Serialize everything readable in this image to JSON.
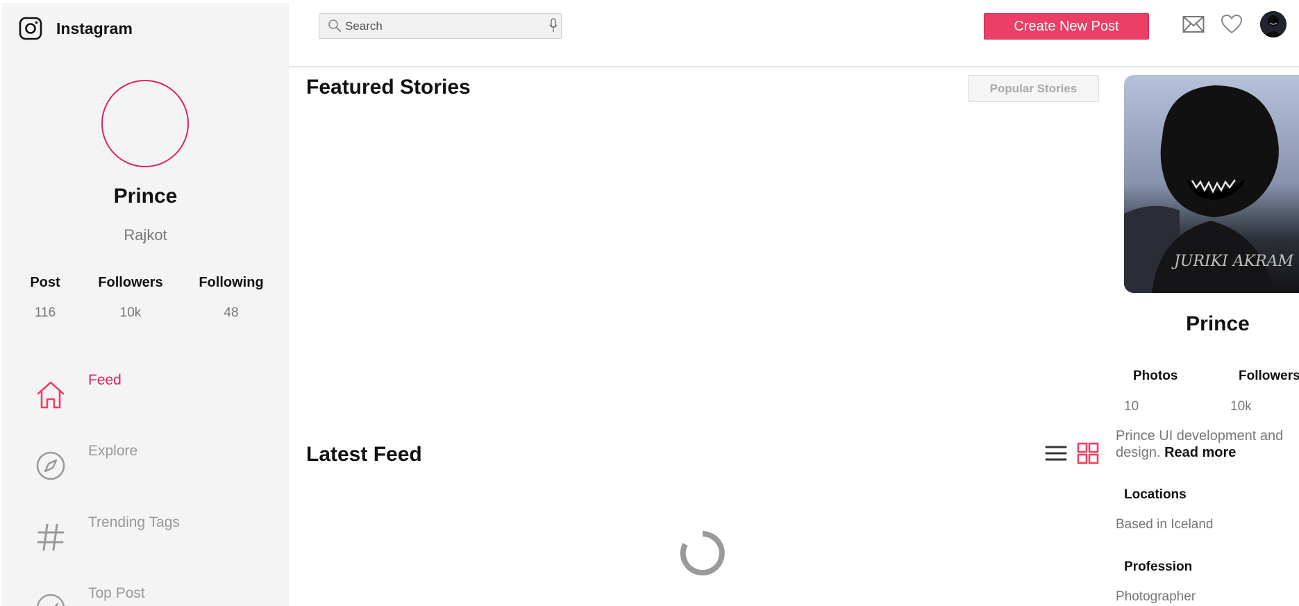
{
  "app": {
    "name": "Instagram"
  },
  "sidebar": {
    "profile": {
      "name": "Prince",
      "location": "Rajkot"
    },
    "stats": [
      {
        "label": "Post",
        "value": "116"
      },
      {
        "label": "Followers",
        "value": "10k"
      },
      {
        "label": "Following",
        "value": "48"
      }
    ],
    "nav": [
      {
        "label": "Feed",
        "icon": "home-icon",
        "active": true
      },
      {
        "label": "Explore",
        "icon": "compass-icon",
        "active": false
      },
      {
        "label": "Trending Tags",
        "icon": "hashtag-icon",
        "active": false
      },
      {
        "label": "Top Post",
        "icon": "check-circle-icon",
        "active": false
      }
    ]
  },
  "header": {
    "search": {
      "placeholder": "Search",
      "value": ""
    },
    "create_label": "Create New Post",
    "icons": [
      "search-icon",
      "mic-icon",
      "mail-icon",
      "heart-icon",
      "avatar"
    ]
  },
  "main": {
    "featured_title": "Featured Stories",
    "popular_label": "Popular Stories",
    "latest_title": "Latest Feed"
  },
  "right_panel": {
    "name": "Prince",
    "stats": [
      {
        "label": "Photos",
        "value": "10"
      },
      {
        "label": "Followers",
        "value": "10k"
      }
    ],
    "bio": "Prince UI development and design.",
    "read_more": "Read more",
    "location_title": "Locations",
    "location_value": "Based in Iceland",
    "profession_title": "Profession",
    "profession_value": "Photographer",
    "photo_caption": "JURIKI AKRAM"
  },
  "colors": {
    "accent": "#e0245e",
    "button": "#ec3f65",
    "sidebar_bg": "#f4f4f4",
    "muted_text": "#777777"
  }
}
